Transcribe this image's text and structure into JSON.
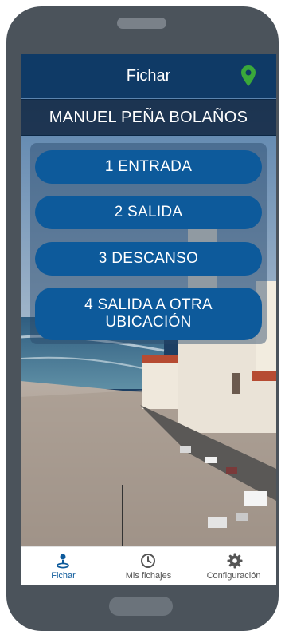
{
  "header": {
    "title": "Fichar",
    "location_icon": "map-marker-icon",
    "accent": "#3aa83a"
  },
  "user": {
    "name": "MANUEL PEÑA BOLAÑOS"
  },
  "actions": [
    {
      "label": "1  ENTRADA"
    },
    {
      "label": "2  SALIDA"
    },
    {
      "label": "3  DESCANSO"
    },
    {
      "label": "4  SALIDA A OTRA UBICACIÓN"
    }
  ],
  "nav": [
    {
      "label": "Fichar",
      "icon": "person-pin-icon",
      "active": true
    },
    {
      "label": "Mis fichajes",
      "icon": "clock-icon",
      "active": false
    },
    {
      "label": "Configuración",
      "icon": "gear-icon",
      "active": false
    }
  ],
  "colors": {
    "primary": "#0d5a9b",
    "header": "#0f3a66"
  }
}
